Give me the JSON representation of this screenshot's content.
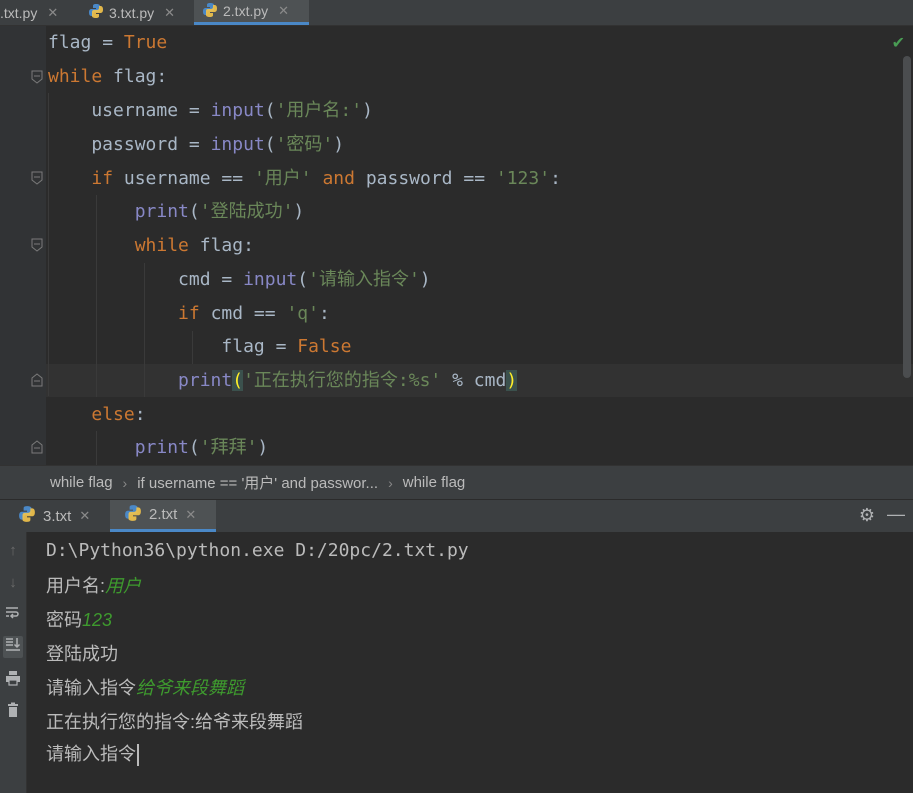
{
  "editor_tabs": [
    {
      "label": ".txt.py",
      "active": false
    },
    {
      "label": "3.txt.py",
      "active": false
    },
    {
      "label": "2.txt.py",
      "active": true
    }
  ],
  "code": {
    "l1": {
      "a": "flag",
      "b": " = ",
      "c": "True"
    },
    "l2": {
      "a": "while",
      "b": " flag:"
    },
    "l3": {
      "a": "    username = ",
      "b": "input",
      "c": "(",
      "d": "'用户名:'",
      "e": ")"
    },
    "l4": {
      "a": "    password = ",
      "b": "input",
      "c": "(",
      "d": "'密码'",
      "e": ")"
    },
    "l5": {
      "a": "    ",
      "b": "if",
      "c": " username == ",
      "d": "'用户'",
      "e": " ",
      "f": "and",
      "g": " password == ",
      "h": "'123'",
      "i": ":"
    },
    "l6": {
      "a": "        ",
      "b": "print",
      "c": "(",
      "d": "'登陆成功'",
      "e": ")"
    },
    "l7": {
      "a": "        ",
      "b": "while",
      "c": " flag:"
    },
    "l8": {
      "a": "            cmd = ",
      "b": "input",
      "c": "(",
      "d": "'请输入指令'",
      "e": ")"
    },
    "l9": {
      "a": "            ",
      "b": "if",
      "c": " cmd == ",
      "d": "'q'",
      "e": ":"
    },
    "l10": {
      "a": "                flag = ",
      "b": "False"
    },
    "l11": {
      "a": "            ",
      "b": "print",
      "c": "(",
      "d": "'正在执行您的指令:%s'",
      "e": " % cmd",
      "f": ")"
    },
    "l12": {
      "a": "    ",
      "b": "else",
      "c": ":"
    },
    "l13": {
      "a": "        ",
      "b": "print",
      "c": "(",
      "d": "'拜拜'",
      "e": ")"
    }
  },
  "breadcrumb": [
    "while flag",
    "if username == '用户' and passwor...",
    "while flag"
  ],
  "run_tabs": [
    {
      "label": "3.txt",
      "active": false
    },
    {
      "label": "2.txt",
      "active": true
    }
  ],
  "console": {
    "line1": "D:\\Python36\\python.exe D:/20pc/2.txt.py",
    "line2_prompt": "用户名:",
    "line2_input": "用户",
    "line3_prompt": "密码",
    "line3_input": "123",
    "line4": "登陆成功",
    "line5_prompt": "请输入指令",
    "line5_input": "给爷来段舞蹈",
    "line6": "正在执行您的指令:给爷来段舞蹈",
    "line7_prompt": "请输入指令"
  },
  "icons": {
    "check": "check-icon",
    "settings": "gear-icon",
    "minimize": "minimize-icon"
  },
  "colors": {
    "keyword": "#cc7832",
    "builtin": "#8888c6",
    "string": "#6a8759",
    "user_input": "#3e9a2e",
    "accent": "#4a88c7"
  }
}
